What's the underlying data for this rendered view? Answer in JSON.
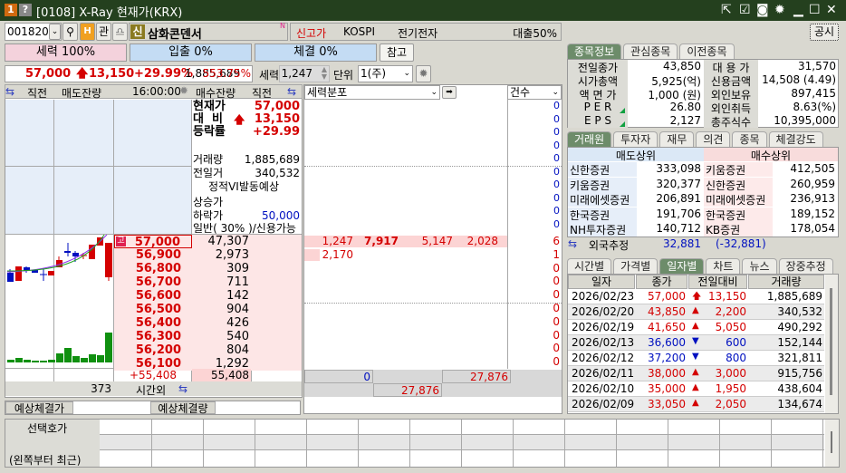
{
  "window": {
    "badge1": "1",
    "badge2": "?",
    "title": "[0108] X-Ray 현재가(KRX)",
    "icons": [
      "detach-icon",
      "checklist-icon",
      "camera-icon",
      "gear-icon",
      "minimize-icon",
      "maximize-icon",
      "close-icon"
    ]
  },
  "toolbar": {
    "code": "001820",
    "stock_badge": "신",
    "stock_name": "삼화콘덴서",
    "new_flag": "N",
    "tag_high": "신고가",
    "market": "KOSPI",
    "sector": "전기전자",
    "loan": "대출50%",
    "gwan": "관",
    "notice_button": "공시"
  },
  "bars": {
    "force": "세력 100%",
    "flow": "입출 0%",
    "exec": "체결 0%",
    "ref_button": "참고"
  },
  "summary": {
    "price": "57,000",
    "change": "13,150",
    "rate": "+29.99%",
    "volume": "1,885,689",
    "vol_ratio": "553.75%",
    "force_label": "세력",
    "force_value": "1,247",
    "unit_label": "단위",
    "unit_value": "1(주)"
  },
  "orderbook": {
    "headers": {
      "prev_left": "직전",
      "ask_qty": "매도잔량",
      "time": "16:00:00",
      "bid_qty": "매수잔량",
      "prev_right": "직전"
    },
    "info": {
      "cur_label": "현재가",
      "cur_value": "57,000",
      "diff_label": "대  비",
      "diff_value": "13,150",
      "rate_label": "등락률",
      "rate_value": "+29.99",
      "vol_label": "거래량",
      "vol_value": "1,885,689",
      "prev_label": "전일거",
      "prev_value": "340,532",
      "vi_label": "정적VI발동예상",
      "upper_label": "상승가",
      "upper_value": "",
      "lower_label": "하락가",
      "lower_value": "50,000",
      "margin_label": "일반( 30% )/신용가능"
    },
    "bids": [
      {
        "price": "57,000",
        "qty": "47,307",
        "badge": "고"
      },
      {
        "price": "56,900",
        "qty": "2,973"
      },
      {
        "price": "56,800",
        "qty": "309"
      },
      {
        "price": "56,700",
        "qty": "711"
      },
      {
        "price": "56,600",
        "qty": "142"
      },
      {
        "price": "56,500",
        "qty": "904"
      },
      {
        "price": "56,400",
        "qty": "426"
      },
      {
        "price": "56,300",
        "qty": "540"
      },
      {
        "price": "56,200",
        "qty": "804"
      },
      {
        "price": "56,100",
        "qty": "1,292"
      }
    ],
    "total_diff": "+55,408",
    "total_bid": "55,408",
    "after_hours_qty": "373",
    "after_hours_label": "시간외",
    "expected_price_label": "예상체결가",
    "expected_price": "",
    "expected_qty_label": "예상체결량",
    "expected_qty": ""
  },
  "distribution": {
    "header": "세력분포",
    "count_header": "건수",
    "rows": [
      [
        "1,247",
        "7,917",
        "5,147",
        "2,028"
      ],
      [
        "2,170",
        "",
        "",
        ""
      ]
    ],
    "counts_top": [
      "0",
      "0",
      "0",
      "0",
      "0",
      "0",
      "0",
      "0",
      "0",
      "0"
    ],
    "counts": [
      "6",
      "1",
      "0",
      "0",
      "0",
      "0",
      "0",
      "0",
      "0",
      "0"
    ],
    "sum_left": "0",
    "sum_right": "27,876",
    "sum_total": "27,876"
  },
  "info_tabs": [
    "종목정보",
    "관심종목",
    "이전종목"
  ],
  "stock_info": [
    [
      "전일종가",
      "43,850",
      "대 용 가",
      "31,570"
    ],
    [
      "시가총액",
      "5,925(억)",
      "신용금액",
      "14,508  (4.49)"
    ],
    [
      "액 면 가",
      "1,000 (원)",
      "외인보유",
      "897,415"
    ],
    [
      "P E R",
      "26.80",
      "외인취득",
      "8.63(%)"
    ],
    [
      "E P S",
      "2,127",
      "총주식수",
      "10,395,000"
    ]
  ],
  "broker_tabs": [
    "거래원",
    "투자자",
    "재무",
    "의견",
    "종목",
    "체결강도"
  ],
  "brokers": {
    "sell_header": "매도상위",
    "buy_header": "매수상위",
    "rows": [
      [
        "신한증권",
        "333,098",
        "키움증권",
        "412,505"
      ],
      [
        "키움증권",
        "320,377",
        "신한증권",
        "260,959"
      ],
      [
        "미래에셋증권",
        "206,891",
        "미래에셋증권",
        "236,913"
      ],
      [
        "한국증권",
        "191,706",
        "한국증권",
        "189,152"
      ],
      [
        "NH투자증권",
        "140,712",
        "KB증권",
        "178,054"
      ]
    ],
    "foreign_label": "외국추정",
    "foreign_sell": "32,881",
    "foreign_buy": "(-32,881)"
  },
  "daily_tabs": [
    "시간별",
    "가격별",
    "일자별",
    "차트",
    "뉴스",
    "장중추정"
  ],
  "daily": {
    "headers": [
      "일자",
      "종가",
      "전일대비",
      "거래량"
    ],
    "rows": [
      {
        "date": "2026/02/23",
        "close": "57,000",
        "dir": "upper",
        "diff": "13,150",
        "vol": "1,885,689"
      },
      {
        "date": "2026/02/20",
        "close": "43,850",
        "dir": "up",
        "diff": "2,200",
        "vol": "340,532"
      },
      {
        "date": "2026/02/19",
        "close": "41,650",
        "dir": "up",
        "diff": "5,050",
        "vol": "490,292"
      },
      {
        "date": "2026/02/13",
        "close": "36,600",
        "dir": "down",
        "diff": "600",
        "vol": "152,144"
      },
      {
        "date": "2026/02/12",
        "close": "37,200",
        "dir": "down",
        "diff": "800",
        "vol": "321,811"
      },
      {
        "date": "2026/02/11",
        "close": "38,000",
        "dir": "up",
        "diff": "3,000",
        "vol": "915,756"
      },
      {
        "date": "2026/02/10",
        "close": "35,000",
        "dir": "up",
        "diff": "1,950",
        "vol": "438,604"
      },
      {
        "date": "2026/02/09",
        "close": "33,050",
        "dir": "up",
        "diff": "2,050",
        "vol": "134,674"
      }
    ]
  },
  "selected": {
    "label1": "선택호가",
    "label2": "(왼쪽부터 최근)"
  },
  "colors": {
    "title_bg": "#24401e",
    "up": "#d40000",
    "down": "#0010c0",
    "pink": "#f4d2dc",
    "blue": "#c4dcf4",
    "tab_active": "#6d8c6a"
  }
}
